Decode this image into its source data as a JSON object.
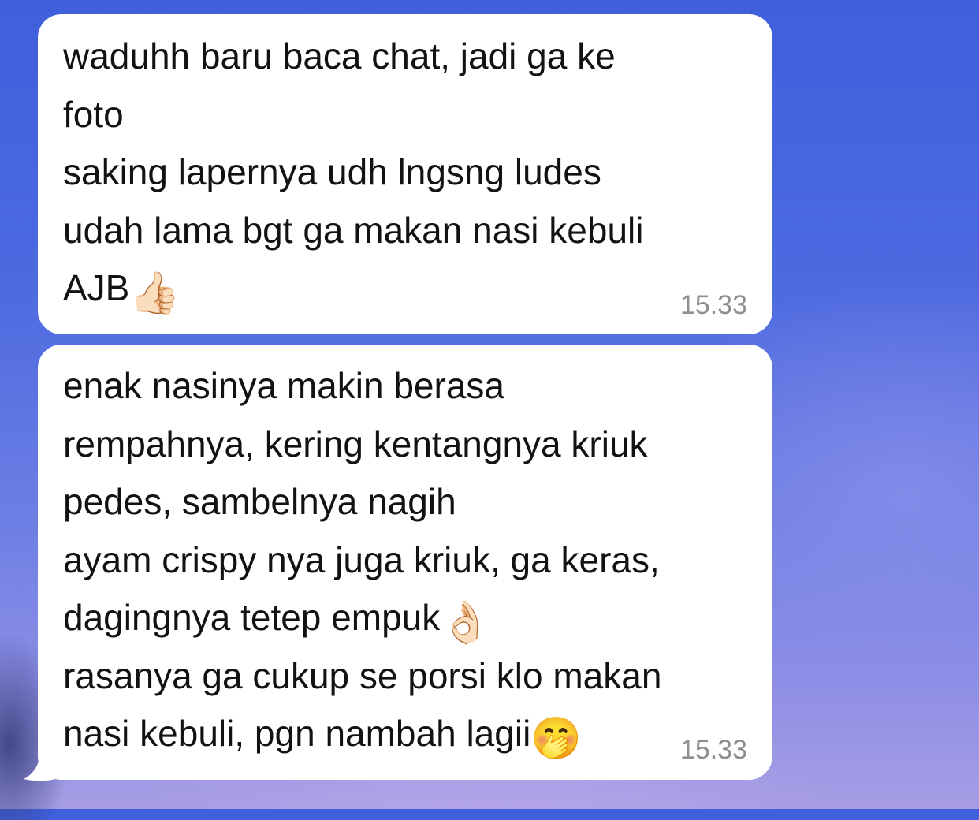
{
  "chat": {
    "messages": [
      {
        "text": "waduhh baru baca chat, jadi ga ke\nfoto\nsaking lapernya udh lngsng ludes\nudah lama bgt ga makan nasi kebuli\nAJB",
        "emoji": "👍🏻",
        "emoji_name": "thumbs-up-emoji",
        "time": "15.33"
      },
      {
        "text_part1": "enak nasinya makin berasa\nrempahnya, kering kentangnya kriuk\npedes, sambelnya nagih\nayam crispy nya juga kriuk, ga keras,\ndagingnya tetep empuk",
        "emoji_part1": "👌🏻",
        "emoji_part1_name": "ok-hand-emoji",
        "text_part2": "\nrasanya ga cukup se porsi klo makan\nnasi kebuli, pgn nambah lagii",
        "emoji_part2": "🤭",
        "emoji_part2_name": "hand-over-mouth-emoji",
        "time": "15.33"
      }
    ]
  },
  "colors": {
    "bubble_bg": "#ffffff",
    "text": "#121212",
    "timestamp": "#8e8e93",
    "background_top": "#3f5fdc",
    "background_bottom": "#a69de4"
  }
}
